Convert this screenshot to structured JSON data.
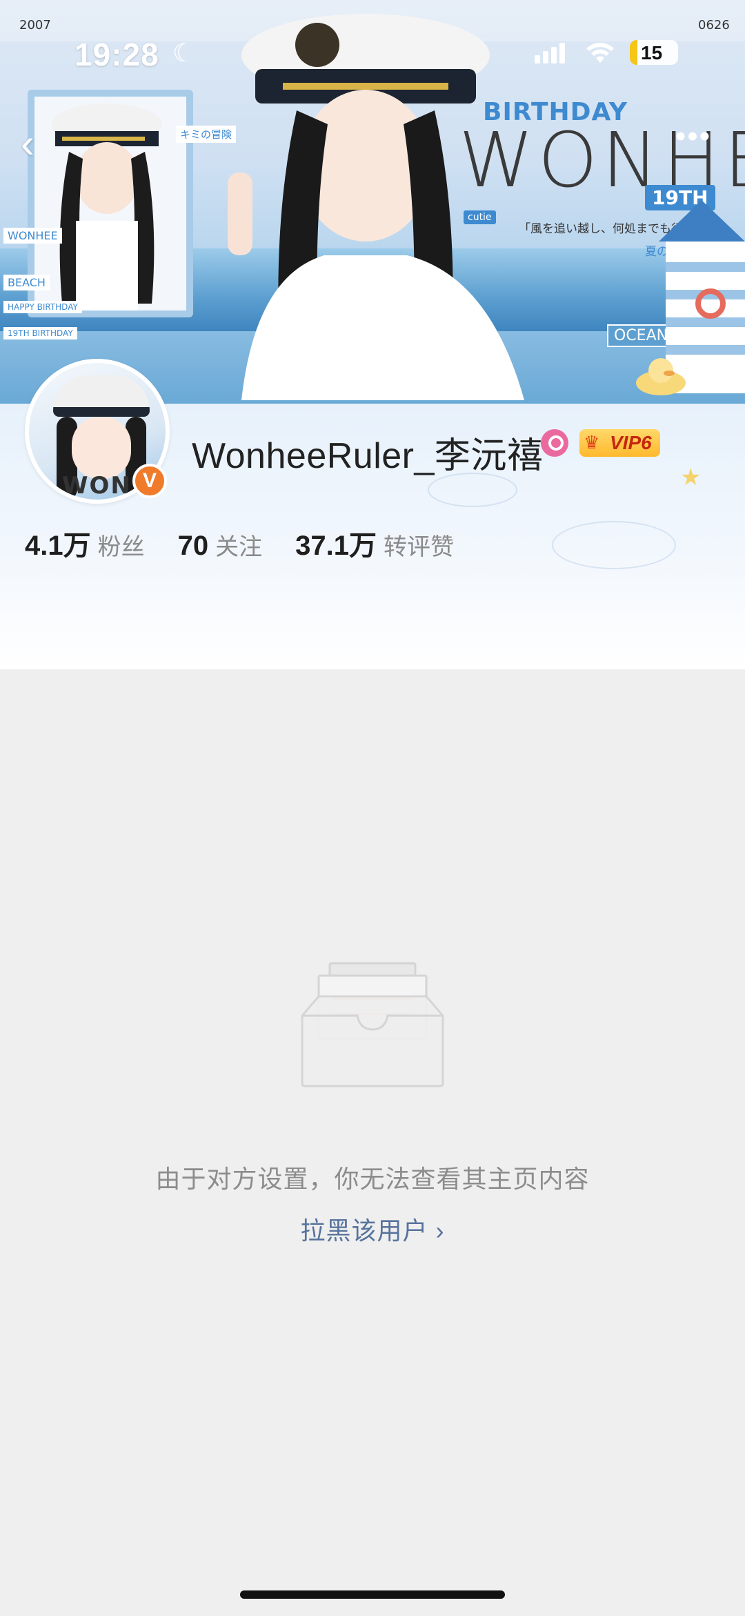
{
  "status_bar": {
    "time": "19:28",
    "battery": "15",
    "battery_color": "#f5c518"
  },
  "banner": {
    "year_left": "2007",
    "year_right": "0626",
    "birthday": "BIRTHDAY",
    "name_art": "WONHEE",
    "age_tag": "19TH",
    "quote": "「風を追い越し、何処までも行こう」",
    "sonata": "夏のソナタ",
    "ocean": "OCEAN",
    "cutie": "cutie",
    "kimi": "キミの冒険",
    "side_tags": [
      "WONHEE",
      "BEACH",
      "HAPPY BIRTHDAY",
      "19TH BIRTHDAY"
    ]
  },
  "nav": {
    "back_icon": "chevron-left-icon",
    "more_icon": "ellipsis-icon"
  },
  "profile": {
    "username": "WonheeRuler_李沅禧",
    "avatar_text": "WONHEE",
    "verified_mark": "V",
    "verified_color": "#f07b2a",
    "vip_label": "VIP6",
    "stats": [
      {
        "value": "4.1万",
        "label": "粉丝"
      },
      {
        "value": "70",
        "label": "关注"
      },
      {
        "value": "37.1万",
        "label": "转评赞"
      }
    ]
  },
  "empty_state": {
    "message": "由于对方设置，你无法查看其主页内容",
    "action_label": "拉黑该用户 ›",
    "action_color": "#57739c"
  }
}
